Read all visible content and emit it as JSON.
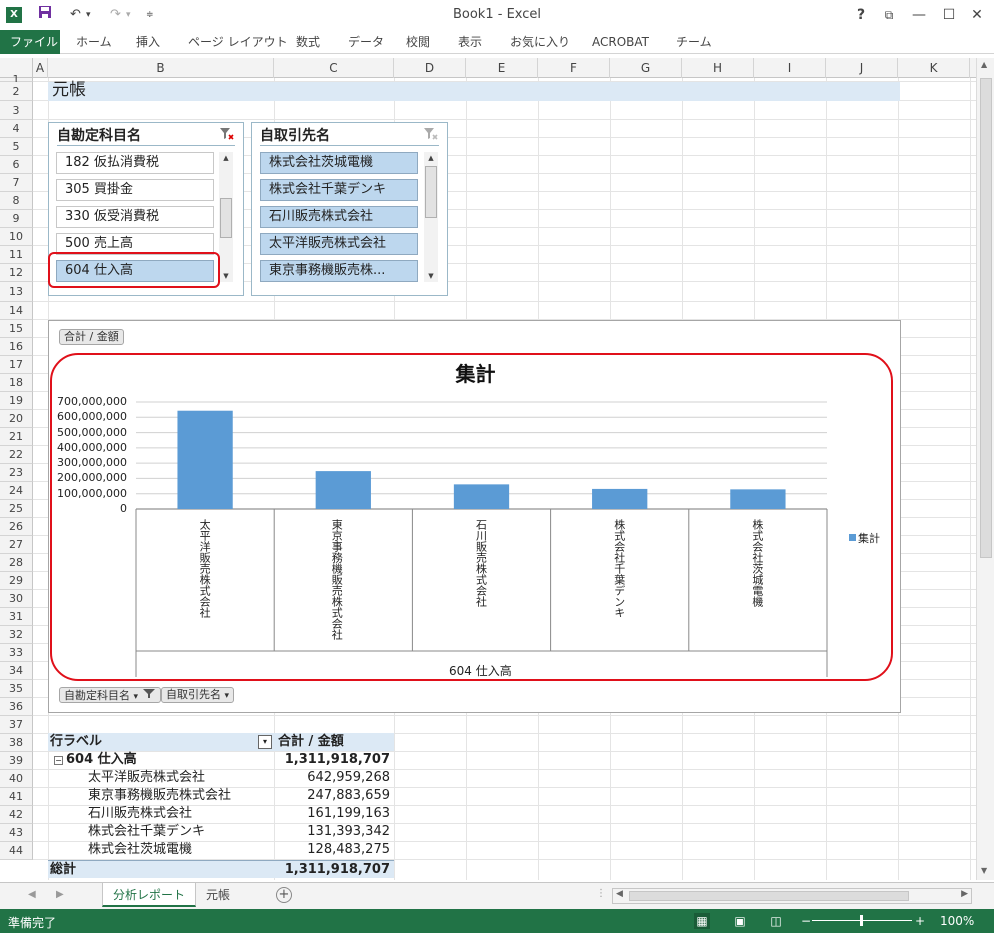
{
  "window": {
    "title": "Book1 - Excel",
    "logo": "X",
    "buttons": {
      "help": "?",
      "restore": "⧉",
      "minimize": "—",
      "maximize": "☐",
      "close": "✕"
    }
  },
  "ribbon": {
    "tabs": [
      "ファイル",
      "ホーム",
      "挿入",
      "ページ レイアウト",
      "数式",
      "データ",
      "校閲",
      "表示",
      "お気に入り",
      "ACROBAT",
      "チーム"
    ]
  },
  "grid": {
    "columns": [
      "A",
      "B",
      "C",
      "D",
      "E",
      "F",
      "G",
      "H",
      "I",
      "J",
      "K"
    ],
    "rows": [
      "1",
      "2",
      "3",
      "4",
      "5",
      "6",
      "7",
      "8",
      "9",
      "10",
      "11",
      "12",
      "13",
      "14",
      "15",
      "16",
      "17",
      "18",
      "19",
      "20",
      "21",
      "22",
      "23",
      "24",
      "25",
      "26",
      "27",
      "28",
      "29",
      "30",
      "31",
      "32",
      "33",
      "34",
      "35",
      "36",
      "37",
      "38",
      "39",
      "40",
      "41",
      "42",
      "43",
      "44"
    ],
    "title": "元帳"
  },
  "slicer_account": {
    "header": "自勘定科目名",
    "items": [
      "182 仮払消費税",
      "305 買掛金",
      "330 仮受消費税",
      "500 売上高",
      "604 仕入高"
    ],
    "selected_index": 4
  },
  "slicer_partner": {
    "header": "自取引先名",
    "items": [
      "株式会社茨城電機",
      "株式会社千葉デンキ",
      "石川販売株式会社",
      "太平洋販売株式会社",
      "東京事務機販売株..."
    ]
  },
  "chart_buttons": {
    "value_field": "合計 / 金額",
    "filter1": "自勘定科目名",
    "filter2": "自取引先名"
  },
  "chart_data": {
    "type": "bar",
    "title": "集計",
    "categories": [
      "太平洋販売株式会社",
      "東京事務機販売株式会社",
      "石川販売株式会社",
      "株式会社千葉デンキ",
      "株式会社茨城電機"
    ],
    "series": [
      {
        "name": "集計",
        "values": [
          642959268,
          247883659,
          161199163,
          131393342,
          128483275
        ]
      }
    ],
    "ylim": [
      0,
      700000000
    ],
    "yticks": [
      "700,000,000",
      "600,000,000",
      "500,000,000",
      "400,000,000",
      "300,000,000",
      "200,000,000",
      "100,000,000",
      "0"
    ],
    "xlabel": "604 仕入高",
    "legend": "right",
    "grid": true,
    "color": "#5b9bd5"
  },
  "pivot": {
    "row_label_header": "行ラベル",
    "value_header": "合計 / 金額",
    "group_label": "604 仕入高",
    "group_total": "1,311,918,707",
    "rows": [
      {
        "label": "太平洋販売株式会社",
        "value": "642,959,268"
      },
      {
        "label": "東京事務機販売株式会社",
        "value": "247,883,659"
      },
      {
        "label": "石川販売株式会社",
        "value": "161,199,163"
      },
      {
        "label": "株式会社千葉デンキ",
        "value": "131,393,342"
      },
      {
        "label": "株式会社茨城電機",
        "value": "128,483,275"
      }
    ],
    "grand_total_label": "総計",
    "grand_total": "1,311,918,707"
  },
  "sheet_tabs": [
    "分析レポート",
    "元帳"
  ],
  "status": {
    "text": "準備完了",
    "zoom": "100%"
  }
}
